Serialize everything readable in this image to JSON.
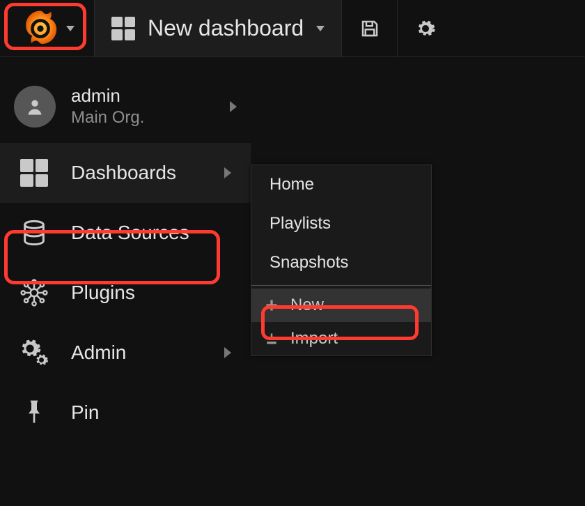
{
  "topbar": {
    "title": "New dashboard"
  },
  "user": {
    "name": "admin",
    "org": "Main Org."
  },
  "menu": {
    "dashboards": "Dashboards",
    "datasources": "Data Sources",
    "plugins": "Plugins",
    "admin": "Admin",
    "pin": "Pin"
  },
  "submenu": {
    "home": "Home",
    "playlists": "Playlists",
    "snapshots": "Snapshots",
    "new": "New",
    "import": "Import"
  }
}
